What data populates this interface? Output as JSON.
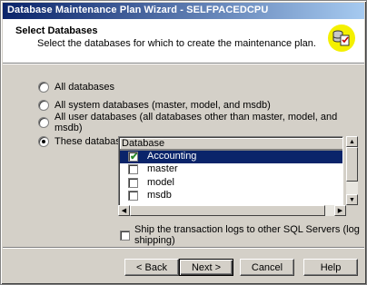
{
  "window": {
    "title": "Database Maintenance Plan Wizard - SELFPACEDCPU"
  },
  "header": {
    "title": "Select Databases",
    "subtitle": "Select the databases for which to create the maintenance plan.",
    "icon": "database-check-icon",
    "icon_color": "#f4f000"
  },
  "options": [
    {
      "label": "All databases",
      "selected": false
    },
    {
      "label": "All system databases (master, model, and msdb)",
      "selected": false
    },
    {
      "label": "All user databases (all databases other than master, model, and msdb)",
      "selected": false
    },
    {
      "label": "These databases:",
      "selected": true
    }
  ],
  "database_list": {
    "column_header": "Database",
    "rows": [
      {
        "name": "Accounting",
        "checked": true,
        "selected": true
      },
      {
        "name": "master",
        "checked": false,
        "selected": false
      },
      {
        "name": "model",
        "checked": false,
        "selected": false
      },
      {
        "name": "msdb",
        "checked": false,
        "selected": false
      }
    ]
  },
  "log_shipping": {
    "label": "Ship the transaction logs to other SQL Servers (log shipping)",
    "checked": false
  },
  "buttons": {
    "back": "< Back",
    "next": "Next >",
    "cancel": "Cancel",
    "help": "Help"
  },
  "colors": {
    "title_bar": "#0a246a",
    "selection": "#0a246a",
    "dialog_face": "#d4d0c8"
  }
}
